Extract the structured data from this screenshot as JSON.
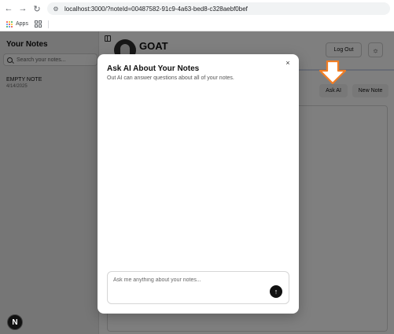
{
  "browser": {
    "url": "localhost:3000/?noteId=00487582-91c9-4a63-bed8-c328aebf0bef",
    "back_icon": "arrow-left-icon",
    "forward_icon": "arrow-right-icon",
    "reload_icon": "reload-icon",
    "bookmarks": {
      "apps_label": "Apps"
    }
  },
  "sidebar": {
    "title": "Your Notes",
    "search_placeholder": "Search your notes...",
    "notes": [
      {
        "title": "EMPTY NOTE",
        "date": "4/14/2025"
      }
    ]
  },
  "header": {
    "logo_text": "GOAT",
    "logout_label": "Log Out",
    "theme_icon": "sun-icon"
  },
  "toolbar": {
    "ask_ai_label": "Ask AI",
    "new_note_label": "New Note"
  },
  "modal": {
    "title": "Ask AI About Your Notes",
    "subtitle": "Out AI can answer questions about all of your notes.",
    "close_glyph": "×",
    "input_placeholder": "Ask me anything about your notes...",
    "send_glyph": "↑"
  },
  "badge": {
    "label": "N"
  },
  "colors": {
    "overlay": "rgba(0,0,0,0.5)",
    "arrow_fill": "#ffffff",
    "arrow_stroke": "#f07d24",
    "send_button": "#111111"
  }
}
